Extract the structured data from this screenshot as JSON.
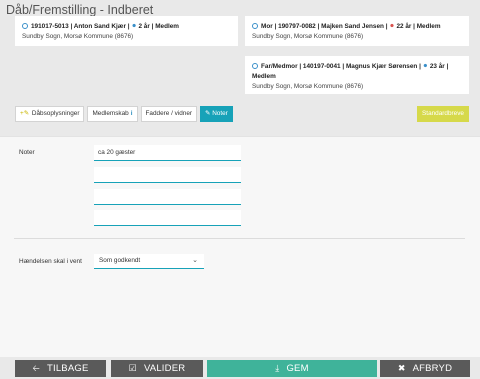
{
  "page": {
    "title": "Dåb/Fremstilling - Indberet"
  },
  "cards": {
    "child": {
      "cpr": "191017-5013",
      "name": "Anton Sand Kjær",
      "age": "2 år",
      "status": "Medlem",
      "address": "Sundby Sogn, Morsø Kommune (8676)"
    },
    "mother": {
      "role": "Mor",
      "cpr": "190797-0082",
      "name": "Majken Sand Jensen",
      "age": "22 år",
      "status": "Medlem",
      "address": "Sundby Sogn, Morsø Kommune (8676)"
    },
    "father": {
      "role": "Far/Medmor",
      "cpr": "140197-0041",
      "name": "Magnus Kjær Sørensen",
      "age": "23 år",
      "status": "Medlem",
      "address": "Sundby Sogn, Morsø Kommune (8676)"
    }
  },
  "tabs": {
    "baptism": "Dåbsoplysninger",
    "membership": "Medlemskab",
    "godparents": "Faddere / vidner",
    "notes": "Noter"
  },
  "standard_letters_label": "Standardbreve",
  "notes_form": {
    "label": "Noter",
    "fields": [
      "ca 20 gæster",
      "",
      "",
      ""
    ]
  },
  "hold_event": {
    "label": "Hændelsen skal i vent",
    "selected": "Som godkendt"
  },
  "footer": {
    "back": "TILBAGE",
    "validate": "VALIDER",
    "save": "GEM",
    "cancel": "AFBRYD"
  },
  "colors": {
    "accent": "#17a2b8",
    "save": "#3fb39a",
    "standard_letters": "#d6d94a",
    "dark_button": "#5a5a5a"
  }
}
